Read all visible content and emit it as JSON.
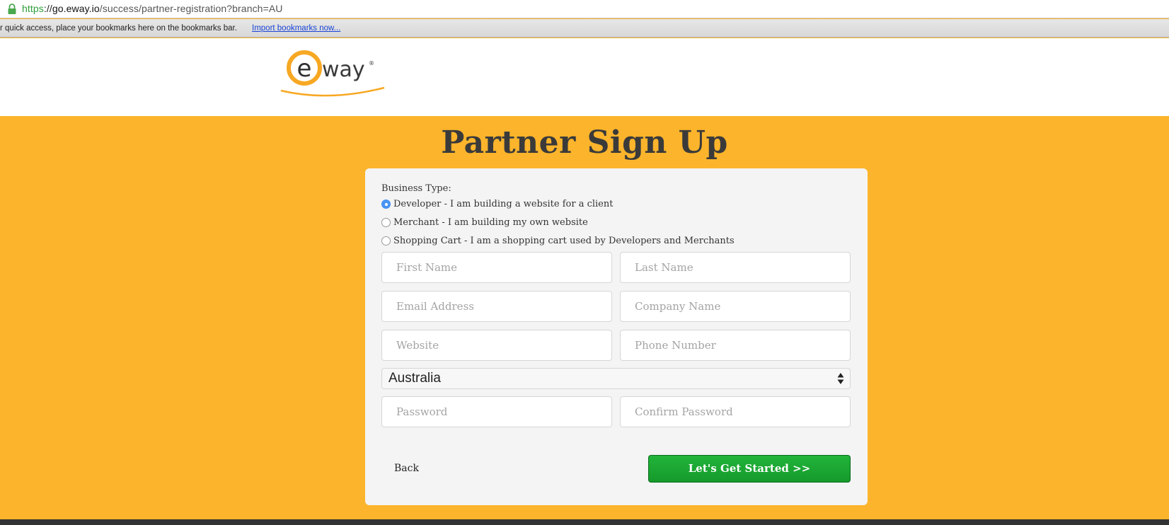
{
  "browser": {
    "url_scheme": "https",
    "url_sep": "://",
    "url_host": "go.eway.io",
    "url_path": "/success/partner-registration?branch=AU",
    "bookmarks_text": "r quick access, place your bookmarks here on the bookmarks bar.",
    "bookmarks_link": "Import bookmarks now..."
  },
  "header": {
    "logo_text": "eway",
    "logo_brand_color": "#f7a823"
  },
  "page": {
    "title": "Partner Sign Up"
  },
  "form": {
    "business_type_label": "Business Type:",
    "business_types": [
      {
        "label": "Developer - I am building a website for a client",
        "checked": true
      },
      {
        "label": "Merchant - I am building my own website",
        "checked": false
      },
      {
        "label": "Shopping Cart - I am a shopping cart used by Developers and Merchants",
        "checked": false
      }
    ],
    "placeholders": {
      "first_name": "First Name",
      "last_name": "Last Name",
      "email": "Email Address",
      "company": "Company Name",
      "website": "Website",
      "phone": "Phone Number",
      "password": "Password",
      "confirm_password": "Confirm Password"
    },
    "country": "Australia",
    "back_label": "Back",
    "submit_label": "Let's Get Started >>"
  },
  "colors": {
    "background": "#fbb42b",
    "submit_green": "#1aa632",
    "radio_selected": "#4a95f3"
  }
}
